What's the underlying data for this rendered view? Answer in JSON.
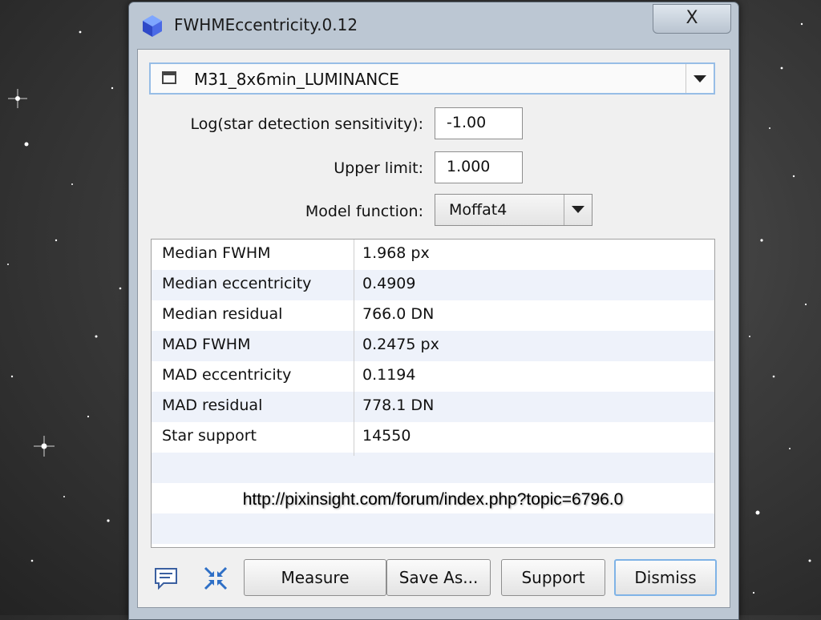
{
  "window": {
    "title": "FWHMEccentricity.0.12",
    "close_label": "X"
  },
  "view_selector": {
    "selected": "M31_8x6min_LUMINANCE"
  },
  "parameters": {
    "sensitivity_label": "Log(star detection sensitivity):",
    "sensitivity_value": "-1.00",
    "upper_limit_label": "Upper limit:",
    "upper_limit_value": "1.000",
    "model_label": "Model function:",
    "model_value": "Moffat4"
  },
  "results": [
    {
      "name": "Median FWHM",
      "value": "1.968 px"
    },
    {
      "name": "Median eccentricity",
      "value": "0.4909"
    },
    {
      "name": "Median residual",
      "value": "766.0 DN"
    },
    {
      "name": "MAD FWHM",
      "value": "0.2475 px"
    },
    {
      "name": "MAD eccentricity",
      "value": "0.1194"
    },
    {
      "name": "MAD residual",
      "value": "778.1 DN"
    },
    {
      "name": "Star support",
      "value": "14550"
    }
  ],
  "url_overlay": "http://pixinsight.com/forum/index.php?topic=6796.0",
  "buttons": {
    "measure": "Measure",
    "save_as": "Save As...",
    "support": "Support",
    "dismiss": "Dismiss"
  },
  "icons": {
    "app": "pixinsight-cube-icon",
    "info": "speech-bubble-icon",
    "collapse": "collapse-arrows-icon"
  }
}
